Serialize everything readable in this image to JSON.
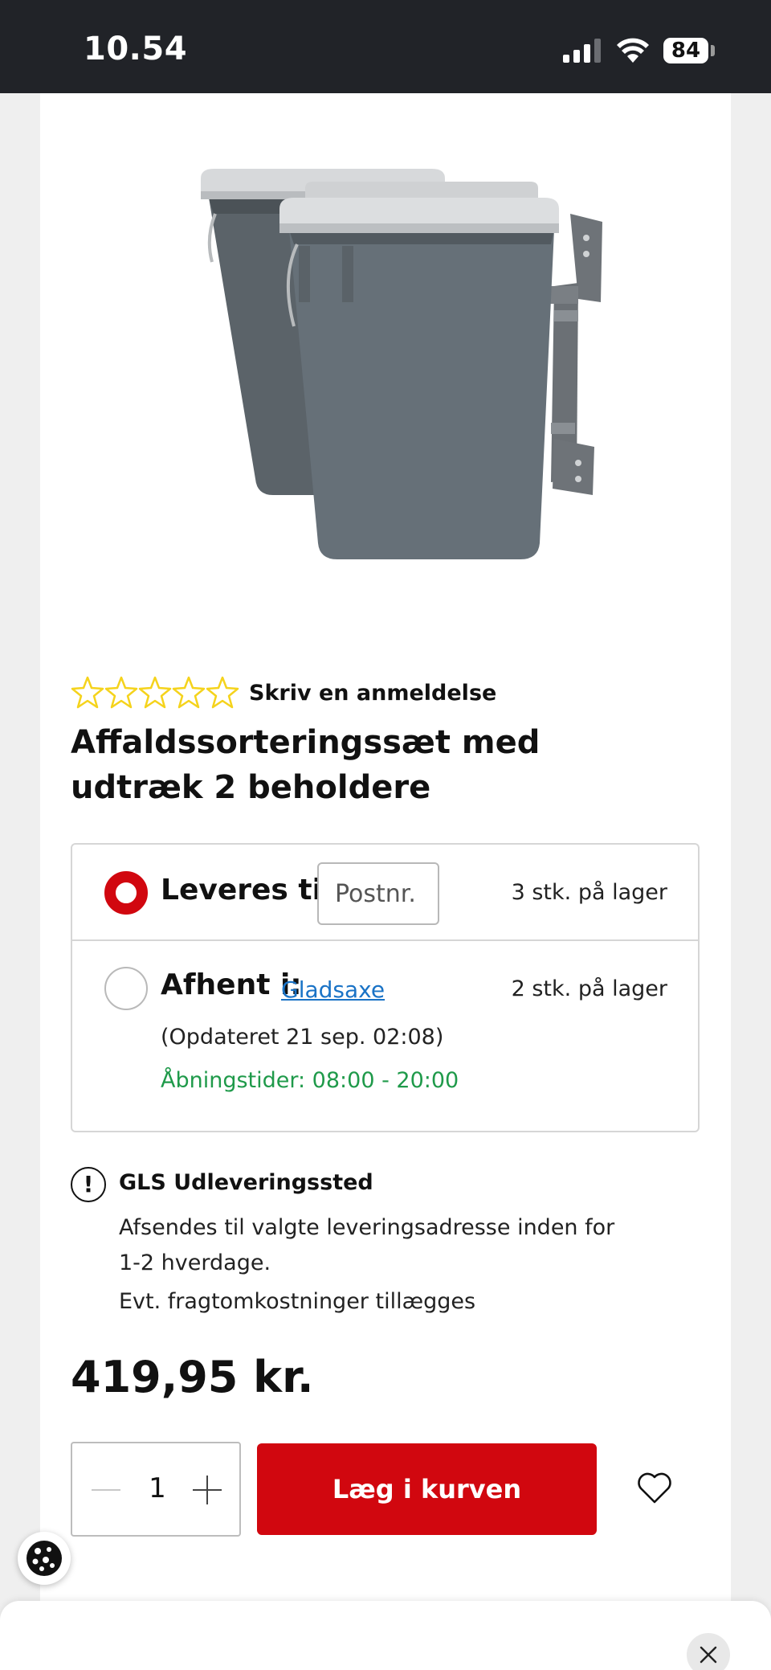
{
  "status_bar": {
    "time": "10.54",
    "battery": "84"
  },
  "product": {
    "review_link": "Skriv en anmeldelse",
    "rating_stars": 0,
    "rating_max": 5,
    "title": "Affaldssorteringssæt med udtræk 2 beholdere"
  },
  "delivery": {
    "ship": {
      "label": "Leveres til:",
      "postcode_placeholder": "Postnr.",
      "stock": "3 stk. på lager",
      "selected": true
    },
    "pickup": {
      "label": "Afhent i:",
      "store": "Gladsaxe",
      "stock": "2 stk. på lager",
      "updated": "(Opdateret 21 sep. 02:08)",
      "hours": "Åbningstider: 08:00 - 20:00",
      "selected": false
    }
  },
  "shipping_info": {
    "title": "GLS Udleveringssted",
    "text": "Afsendes til valgte leveringsadresse inden for 1-2 hverdage.",
    "extra": "Evt. fragtomkostninger tillægges"
  },
  "price": "419,95 kr.",
  "cart": {
    "quantity": "1",
    "add_label": "Læg i kurven"
  },
  "colors": {
    "brand_red": "#d1070f",
    "star_yellow": "#f5d31c",
    "link_blue": "#1a73c6",
    "hours_green": "#1f9a4a"
  },
  "icons": {
    "info": "info-icon",
    "favorite": "heart-icon",
    "cookie": "cookie-icon",
    "close": "close-icon"
  }
}
